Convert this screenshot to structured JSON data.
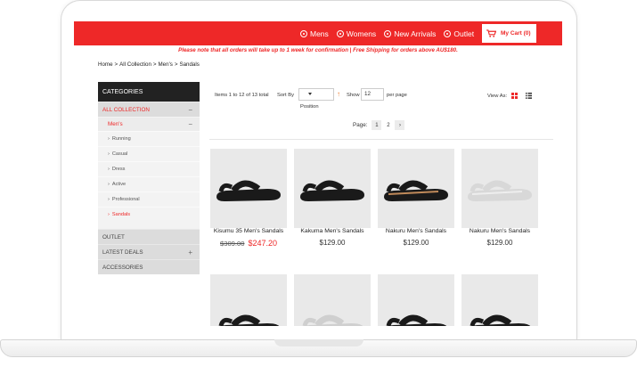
{
  "colors": {
    "brand_red": "#ee2828",
    "dark": "#222222",
    "sidebar_gray": "#dcdcdc"
  },
  "nav": {
    "items": [
      "Mens",
      "Womens",
      "New Arrivals",
      "Outlet"
    ],
    "cart_label": "My Cart (0)"
  },
  "notice": "Please note that all orders will take up to 1 week for confirmation | Free Shipping for orders above AU$180.",
  "breadcrumb": [
    "Home",
    "All Collection",
    "Men's",
    "Sandals"
  ],
  "sidebar": {
    "heading": "CATEGORIES",
    "all_collection": "ALL COLLECTION",
    "mens": "Men's",
    "subcategories": [
      "Running",
      "Casual",
      "Dress",
      "Active",
      "Professional",
      "Sandals"
    ],
    "outlet": "OUTLET",
    "latest_deals": "LATEST DEALS",
    "accessories": "ACCESSORIES"
  },
  "toolbar": {
    "items_count": "Items 1 to 12 of 13 total",
    "sort_by": "Sort By",
    "sort_value": "Position",
    "show": "Show",
    "show_value": "12",
    "per_page": "per page",
    "view_as": "View As:"
  },
  "pager": {
    "label": "Page:",
    "pages": [
      "1",
      "2"
    ]
  },
  "products": [
    {
      "name": "Kisumu 35 Men's Sandals",
      "old_price": "$309.00",
      "price": "$247.20",
      "shoe_color": "#1a1a1a",
      "accent": "#1a1a1a"
    },
    {
      "name": "Kakuma Men's Sandals",
      "price": "$129.00",
      "shoe_color": "#1a1a1a",
      "accent": "#1a1a1a"
    },
    {
      "name": "Nakuru Men's Sandals",
      "price": "$129.00",
      "shoe_color": "#1a1a1a",
      "accent": "#c08a5a"
    },
    {
      "name": "Nakuru Men's Sandals",
      "price": "$129.00",
      "shoe_color": "#d8d8d8",
      "accent": "#eeeeee"
    }
  ]
}
